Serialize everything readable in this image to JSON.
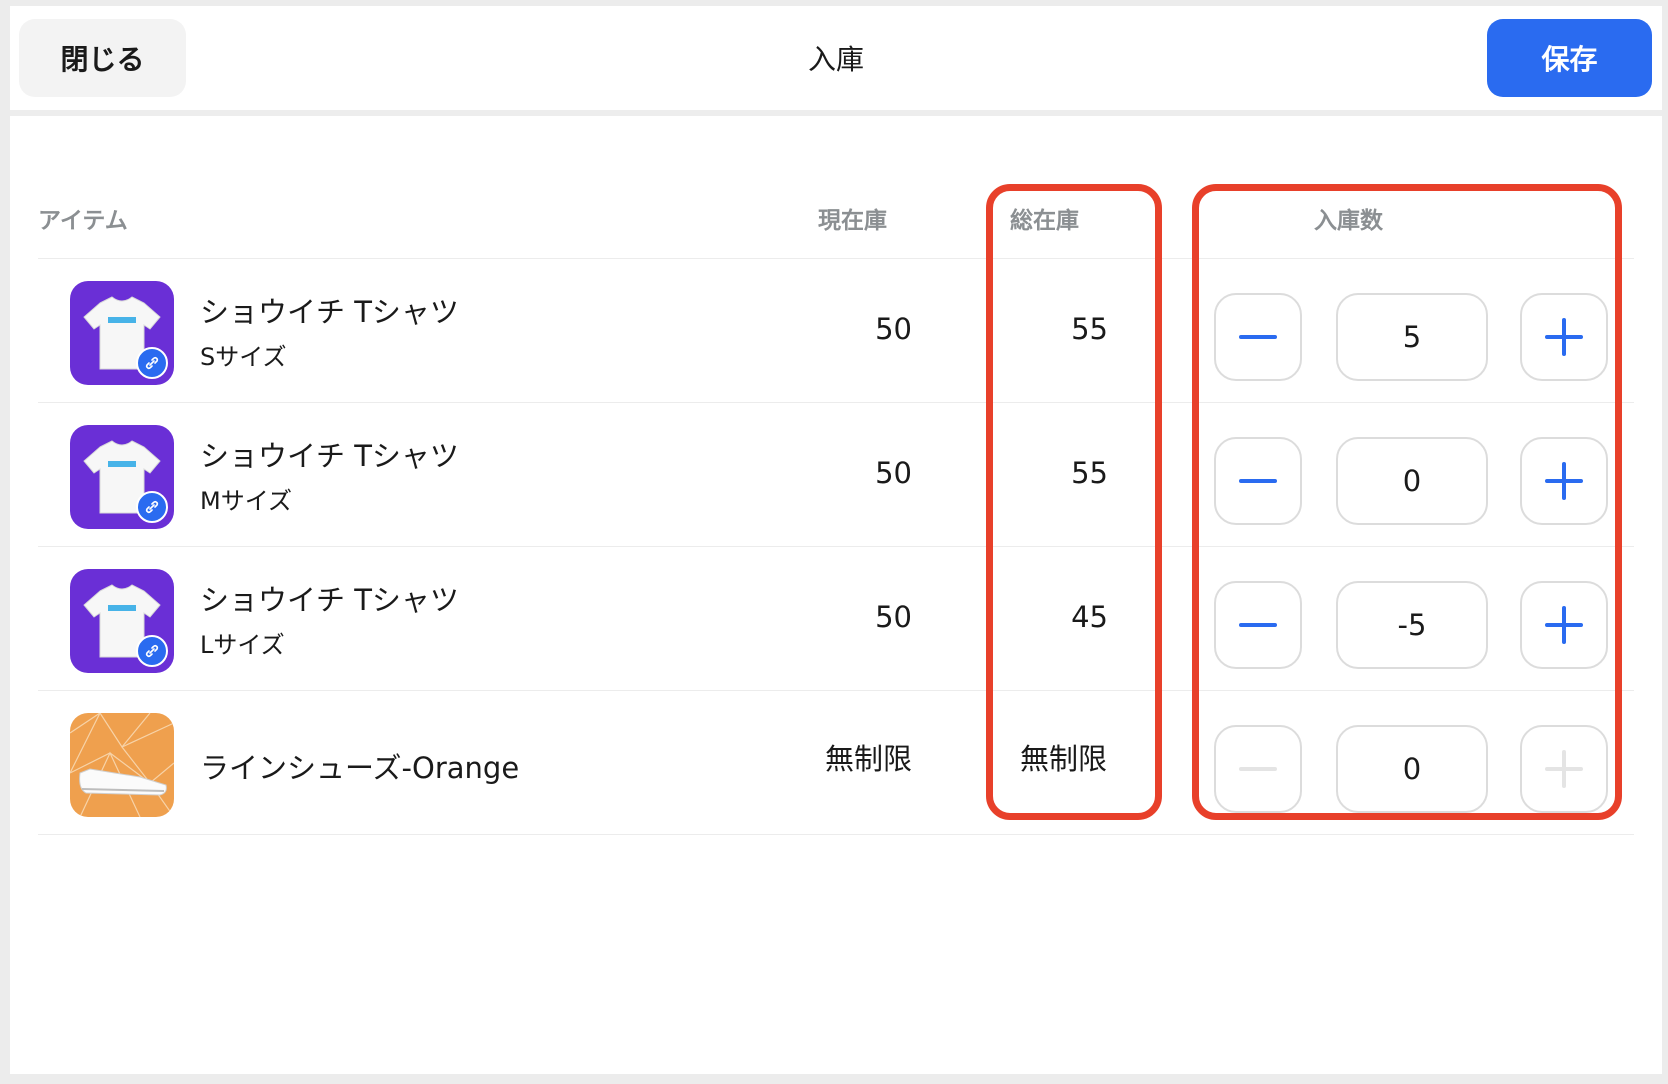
{
  "header": {
    "close_label": "閉じる",
    "title": "入庫",
    "save_label": "保存"
  },
  "columns": {
    "item": "アイテム",
    "current_stock": "現在庫",
    "total_stock": "総在庫",
    "quantity": "入庫数"
  },
  "rows": [
    {
      "name": "ショウイチ Tシャツ",
      "variant": "Sサイズ",
      "current": "50",
      "total": "55",
      "qty": "5",
      "thumb_icon": "tshirt-thumbnail",
      "linked": true,
      "stepper_enabled": true
    },
    {
      "name": "ショウイチ Tシャツ",
      "variant": "Mサイズ",
      "current": "50",
      "total": "55",
      "qty": "0",
      "thumb_icon": "tshirt-thumbnail",
      "linked": true,
      "stepper_enabled": true
    },
    {
      "name": "ショウイチ Tシャツ",
      "variant": "Lサイズ",
      "current": "50",
      "total": "45",
      "qty": "-5",
      "thumb_icon": "tshirt-thumbnail",
      "linked": true,
      "stepper_enabled": true
    },
    {
      "name": "ラインシューズ-Orange",
      "variant": "",
      "current": "無制限",
      "total": "無制限",
      "qty": "0",
      "thumb_icon": "shoe-thumbnail",
      "linked": false,
      "stepper_enabled": false
    }
  ],
  "colors": {
    "accent": "#2a6bf0",
    "highlight": "#e8402a",
    "purple_thumb": "#6a2fd6",
    "orange_thumb": "#efa04e"
  }
}
